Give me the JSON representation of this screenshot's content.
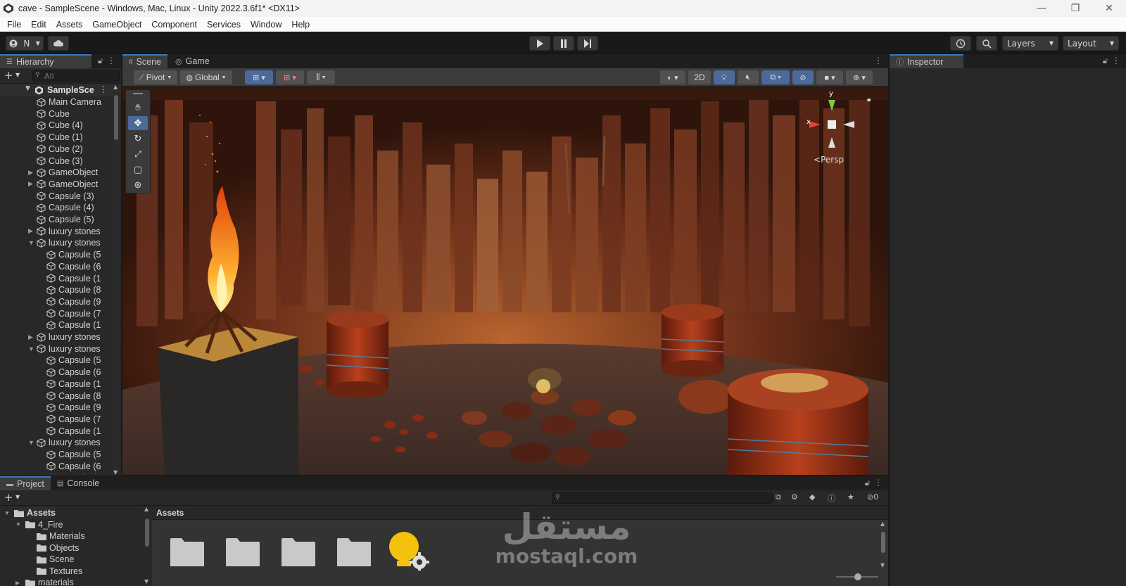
{
  "window": {
    "title": "cave - SampleScene - Windows, Mac, Linux - Unity 2022.3.6f1* <DX11>",
    "controls": [
      "—",
      "❐",
      "✕"
    ]
  },
  "menubar": [
    "File",
    "Edit",
    "Assets",
    "GameObject",
    "Component",
    "Services",
    "Window",
    "Help"
  ],
  "toolbar": {
    "account_label": "N",
    "layers_label": "Layers",
    "layout_label": "Layout"
  },
  "hierarchy": {
    "tab_label": "Hierarchy",
    "search_placeholder": "All",
    "scene_name": "SampleSce",
    "items": [
      {
        "label": "Main Camera",
        "indent": 1,
        "arrow": ""
      },
      {
        "label": "Cube",
        "indent": 1,
        "arrow": ""
      },
      {
        "label": "Cube (4)",
        "indent": 1,
        "arrow": ""
      },
      {
        "label": "Cube (1)",
        "indent": 1,
        "arrow": ""
      },
      {
        "label": "Cube (2)",
        "indent": 1,
        "arrow": ""
      },
      {
        "label": "Cube (3)",
        "indent": 1,
        "arrow": ""
      },
      {
        "label": "GameObject",
        "indent": 1,
        "arrow": "right"
      },
      {
        "label": "GameObject",
        "indent": 1,
        "arrow": "right"
      },
      {
        "label": "Capsule (3)",
        "indent": 1,
        "arrow": ""
      },
      {
        "label": "Capsule (4)",
        "indent": 1,
        "arrow": ""
      },
      {
        "label": "Capsule (5)",
        "indent": 1,
        "arrow": ""
      },
      {
        "label": "luxury stones",
        "indent": 1,
        "arrow": "right"
      },
      {
        "label": "luxury stones",
        "indent": 1,
        "arrow": "down"
      },
      {
        "label": "Capsule (5",
        "indent": 2,
        "arrow": ""
      },
      {
        "label": "Capsule (6",
        "indent": 2,
        "arrow": ""
      },
      {
        "label": "Capsule (1",
        "indent": 2,
        "arrow": ""
      },
      {
        "label": "Capsule (8",
        "indent": 2,
        "arrow": ""
      },
      {
        "label": "Capsule (9",
        "indent": 2,
        "arrow": ""
      },
      {
        "label": "Capsule (7",
        "indent": 2,
        "arrow": ""
      },
      {
        "label": "Capsule (1",
        "indent": 2,
        "arrow": ""
      },
      {
        "label": "luxury stones",
        "indent": 1,
        "arrow": "right"
      },
      {
        "label": "luxury stones",
        "indent": 1,
        "arrow": "down"
      },
      {
        "label": "Capsule (5",
        "indent": 2,
        "arrow": ""
      },
      {
        "label": "Capsule (6",
        "indent": 2,
        "arrow": ""
      },
      {
        "label": "Capsule (1",
        "indent": 2,
        "arrow": ""
      },
      {
        "label": "Capsule (8",
        "indent": 2,
        "arrow": ""
      },
      {
        "label": "Capsule (9",
        "indent": 2,
        "arrow": ""
      },
      {
        "label": "Capsule (7",
        "indent": 2,
        "arrow": ""
      },
      {
        "label": "Capsule (1",
        "indent": 2,
        "arrow": ""
      },
      {
        "label": "luxury stones",
        "indent": 1,
        "arrow": "down"
      },
      {
        "label": "Capsule (5",
        "indent": 2,
        "arrow": ""
      },
      {
        "label": "Capsule (6",
        "indent": 2,
        "arrow": ""
      },
      {
        "label": "Capsule (1",
        "indent": 2,
        "arrow": ""
      }
    ]
  },
  "scene": {
    "tabs": [
      "Scene",
      "Game"
    ],
    "pivot_label": "Pivot",
    "global_label": "Global",
    "mode_2d": "2D",
    "gizmo_y": "y",
    "gizmo_x": "x",
    "persp_label": "Persp"
  },
  "inspector": {
    "tab_label": "Inspector"
  },
  "project": {
    "tabs": [
      "Project",
      "Console"
    ],
    "breadcrumb": "Assets",
    "hidden_count": "0",
    "tree": [
      {
        "label": "Assets",
        "indent": 0,
        "arrow": "down",
        "bold": true
      },
      {
        "label": "4_Fire",
        "indent": 1,
        "arrow": "down",
        "bold": false
      },
      {
        "label": "Materials",
        "indent": 2,
        "arrow": "",
        "bold": false
      },
      {
        "label": "Objects",
        "indent": 2,
        "arrow": "",
        "bold": false
      },
      {
        "label": "Scene",
        "indent": 2,
        "arrow": "",
        "bold": false
      },
      {
        "label": "Textures",
        "indent": 2,
        "arrow": "",
        "bold": false
      },
      {
        "label": "materials",
        "indent": 1,
        "arrow": "right",
        "bold": false
      }
    ],
    "folder_count": 4
  },
  "watermark": {
    "arabic": "مستقل",
    "latin": "mostaql.com"
  },
  "colors": {
    "accent_blue": "#3a79bb",
    "panel_bg": "#282828",
    "toolbar_bg": "#191919",
    "cave_brown": "#5a2a16",
    "fire_orange": "#ff7a1a",
    "sun_yellow": "#f4c20d"
  }
}
